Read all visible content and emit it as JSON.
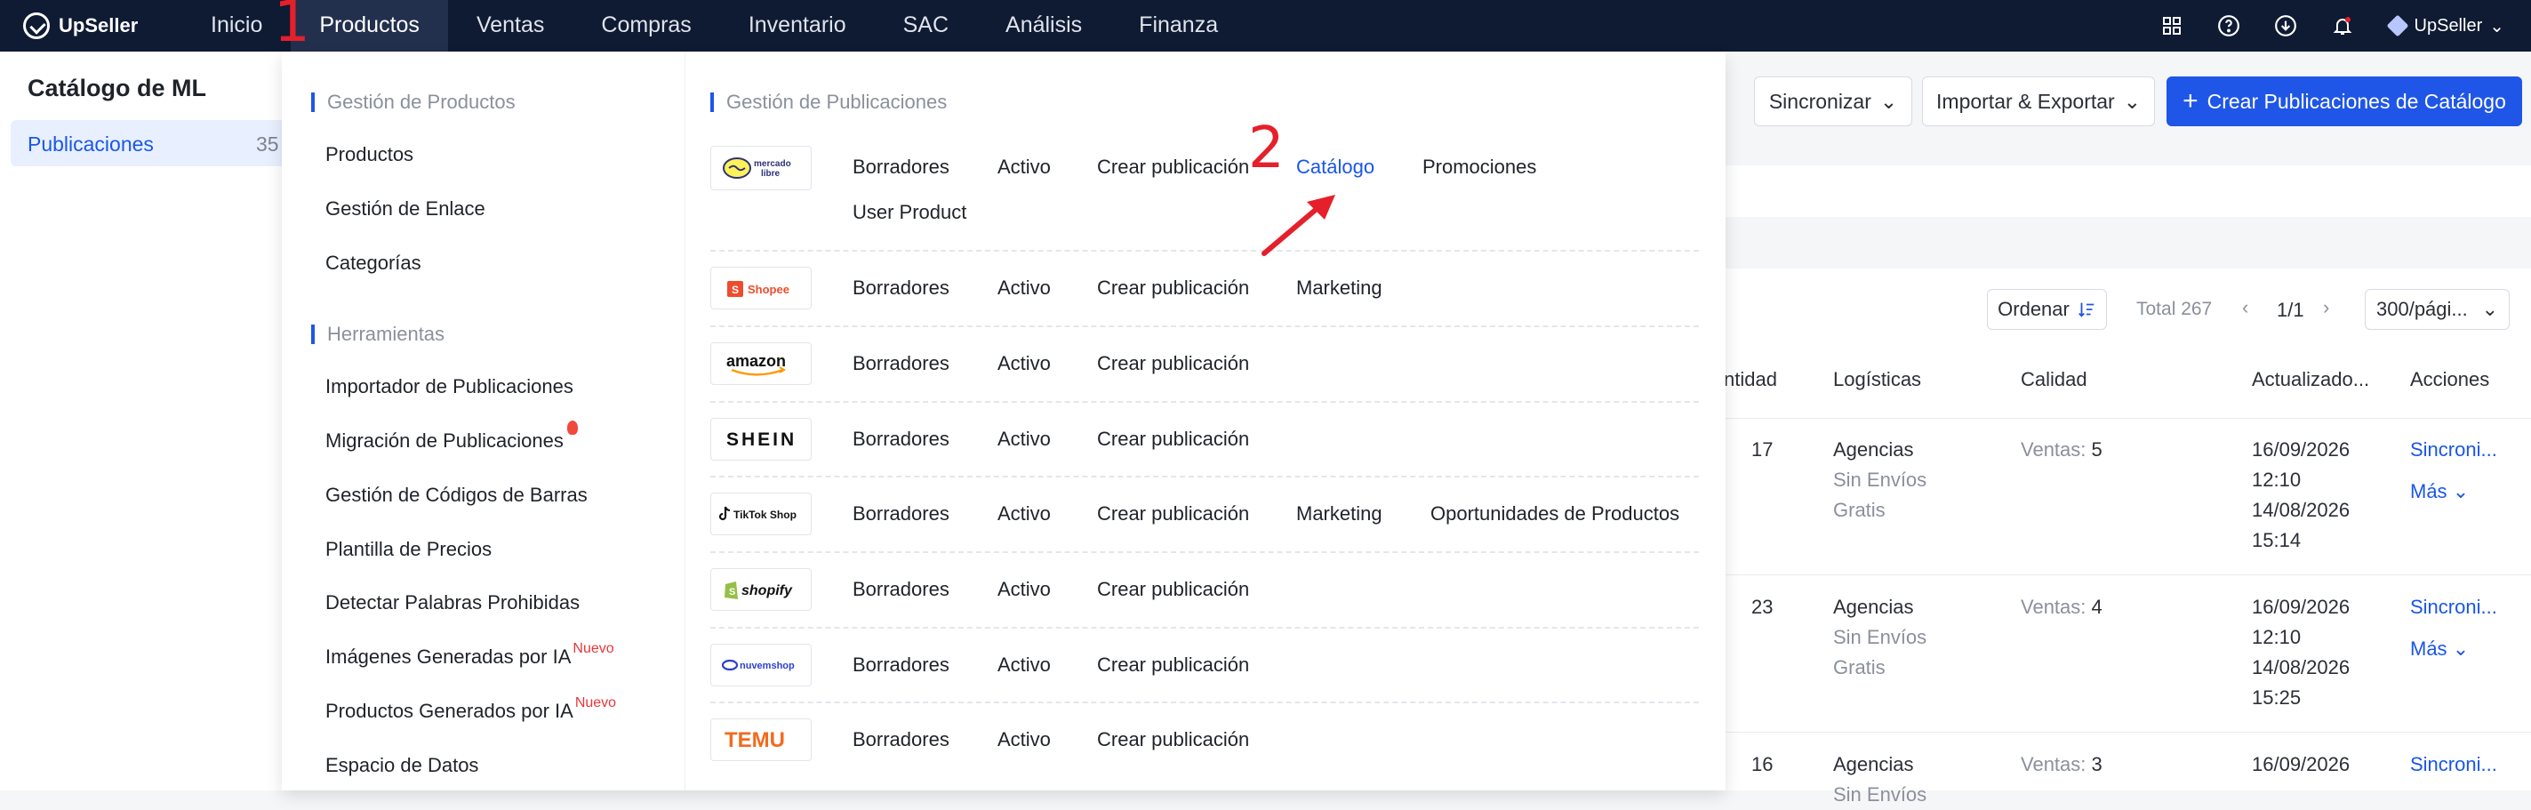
{
  "app": {
    "brand": "UpSeller"
  },
  "topnav": {
    "items": [
      "Inicio",
      "Productos",
      "Ventas",
      "Compras",
      "Inventario",
      "SAC",
      "Análisis",
      "Finanza"
    ],
    "user": "UpSeller"
  },
  "sidebar": {
    "title": "Catálogo de ML",
    "item": "Publicaciones",
    "count": "35"
  },
  "toolbar": {
    "sync": "Sincronizar",
    "import_export": "Importar & Exportar",
    "create": "Crear Publicaciones de Catálogo"
  },
  "table_controls": {
    "sort": "Ordenar",
    "total": "Total 267",
    "page": "1/1",
    "per_page": "300/pági..."
  },
  "table": {
    "headers": [
      "ntidad",
      "Logísticas",
      "Calidad",
      "Actualizado...",
      "Acciones"
    ],
    "rows": [
      {
        "qty": "17",
        "log1": "Agencias",
        "log2": "Sin Envíos",
        "log3": "Gratis",
        "quality_label": "Ventas:",
        "quality_val": "5",
        "d1": "16/09/2026",
        "t1": "12:10",
        "d2": "14/08/2026",
        "t2": "15:14",
        "action": "Sincroni...",
        "more": "Más"
      },
      {
        "qty": "23",
        "log1": "Agencias",
        "log2": "Sin Envíos",
        "log3": "Gratis",
        "quality_label": "Ventas:",
        "quality_val": "4",
        "d1": "16/09/2026",
        "t1": "12:10",
        "d2": "14/08/2026",
        "t2": "15:25",
        "action": "Sincroni...",
        "more": "Más"
      },
      {
        "qty": "16",
        "log1": "Agencias",
        "log2": "Sin Envíos",
        "quality_label": "Ventas:",
        "quality_val": "3",
        "d1": "16/09/2026",
        "action": "Sincroni..."
      }
    ]
  },
  "mega": {
    "left_sections": [
      {
        "title": "Gestión de Productos",
        "items": [
          "Productos",
          "Gestión de Enlace",
          "Categorías"
        ]
      },
      {
        "title": "Herramientas",
        "items": [
          "Importador de Publicaciones",
          "Migración de Publicaciones",
          "Gestión de Códigos de Barras",
          "Plantilla de Precios",
          "Detectar Palabras Prohibidas",
          "Imágenes Generadas por IA",
          "Productos Generados por IA",
          "Espacio de Datos"
        ]
      }
    ],
    "badge_new": "Nuevo",
    "right_title": "Gestión de Publicaciones",
    "platforms": [
      {
        "logo": "mercado libre",
        "links": [
          "Borradores",
          "Activo",
          "Crear publicación",
          "Catálogo",
          "Promociones",
          "User Product"
        ]
      },
      {
        "logo": "Shopee",
        "links": [
          "Borradores",
          "Activo",
          "Crear publicación",
          "Marketing"
        ]
      },
      {
        "logo": "amazon",
        "links": [
          "Borradores",
          "Activo",
          "Crear publicación"
        ]
      },
      {
        "logo": "SHEIN",
        "links": [
          "Borradores",
          "Activo",
          "Crear publicación"
        ]
      },
      {
        "logo": "TikTok Shop",
        "links": [
          "Borradores",
          "Activo",
          "Crear publicación",
          "Marketing",
          "Oportunidades de Productos"
        ]
      },
      {
        "logo": "shopify",
        "links": [
          "Borradores",
          "Activo",
          "Crear publicación"
        ]
      },
      {
        "logo": "nuvemshop",
        "links": [
          "Borradores",
          "Activo",
          "Crear publicación"
        ]
      },
      {
        "logo": "TEMU",
        "links": [
          "Borradores",
          "Activo",
          "Crear publicación"
        ]
      }
    ]
  },
  "annotations": {
    "step1": "1",
    "step2": "2"
  },
  "colors": {
    "accent": "#1f56e8",
    "topbar": "#0f1a33",
    "annotation": "#e5202a"
  }
}
